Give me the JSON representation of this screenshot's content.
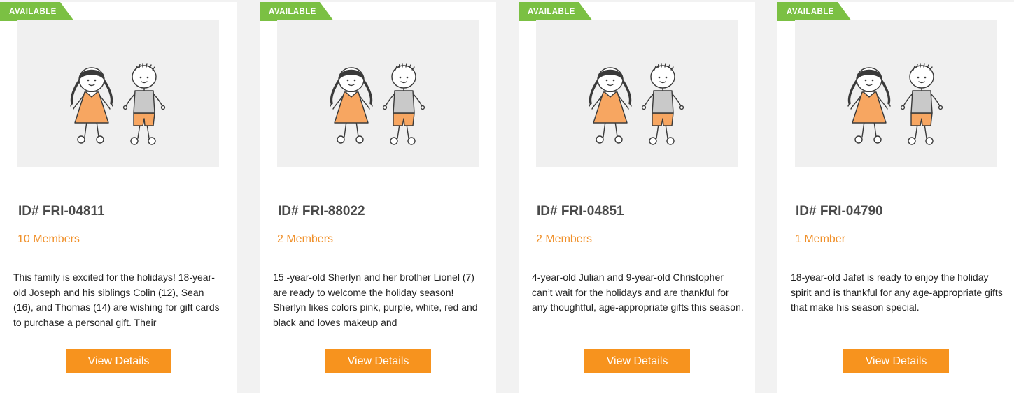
{
  "colors": {
    "ribbon": "#7bc043",
    "accent": "#f7931e",
    "members_text": "#f0902a",
    "card_bg": "#ffffff",
    "page_bg": "#f2f2f2"
  },
  "cards": [
    {
      "status": "AVAILABLE",
      "image_icon": "children-illustration",
      "id": "ID# FRI-04811",
      "members": "10 Members",
      "description": "This family is excited for the holidays! 18-year-old Joseph and his siblings Colin (12), Sean (16), and Thomas (14) are wishing for gift cards to purchase a personal gift. Their",
      "button": "View Details"
    },
    {
      "status": "AVAILABLE",
      "image_icon": "children-illustration",
      "id": "ID# FRI-88022",
      "members": "2 Members",
      "description": "15 -year-old Sherlyn and her brother Lionel (7) are ready to welcome the holiday season! Sherlyn likes colors pink, purple, white, red and black and loves makeup and",
      "button": "View Details"
    },
    {
      "status": "AVAILABLE",
      "image_icon": "children-illustration",
      "id": "ID# FRI-04851",
      "members": "2 Members",
      "description": "4-year-old Julian and 9-year-old Christopher can’t wait for the holidays and are thankful for any thoughtful, age-appropriate gifts this season.",
      "button": "View Details"
    },
    {
      "status": "AVAILABLE",
      "image_icon": "children-illustration",
      "id": "ID# FRI-04790",
      "members": "1 Member",
      "description": "18-year-old Jafet is ready to enjoy the holiday spirit and is thankful for any age-appropriate gifts that make his season special.",
      "button": "View Details"
    }
  ]
}
